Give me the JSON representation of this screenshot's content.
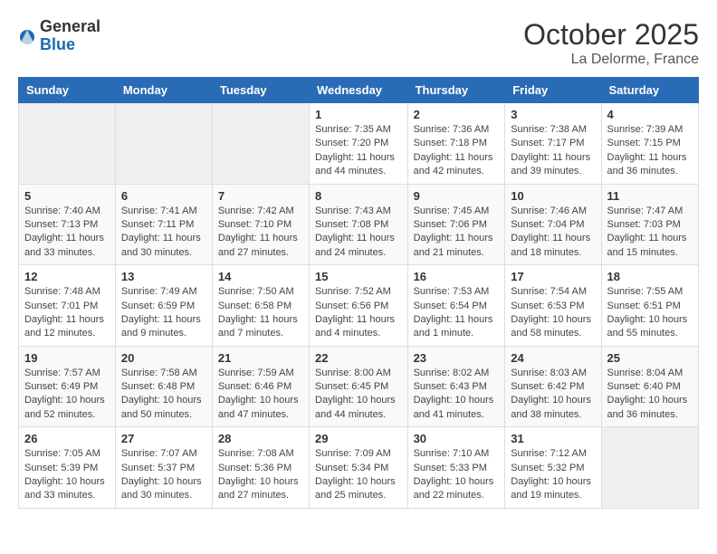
{
  "header": {
    "logo_general": "General",
    "logo_blue": "Blue",
    "month": "October 2025",
    "location": "La Delorme, France"
  },
  "days_of_week": [
    "Sunday",
    "Monday",
    "Tuesday",
    "Wednesday",
    "Thursday",
    "Friday",
    "Saturday"
  ],
  "weeks": [
    [
      {
        "day": "",
        "info": ""
      },
      {
        "day": "",
        "info": ""
      },
      {
        "day": "",
        "info": ""
      },
      {
        "day": "1",
        "info": "Sunrise: 7:35 AM\nSunset: 7:20 PM\nDaylight: 11 hours and 44 minutes."
      },
      {
        "day": "2",
        "info": "Sunrise: 7:36 AM\nSunset: 7:18 PM\nDaylight: 11 hours and 42 minutes."
      },
      {
        "day": "3",
        "info": "Sunrise: 7:38 AM\nSunset: 7:17 PM\nDaylight: 11 hours and 39 minutes."
      },
      {
        "day": "4",
        "info": "Sunrise: 7:39 AM\nSunset: 7:15 PM\nDaylight: 11 hours and 36 minutes."
      }
    ],
    [
      {
        "day": "5",
        "info": "Sunrise: 7:40 AM\nSunset: 7:13 PM\nDaylight: 11 hours and 33 minutes."
      },
      {
        "day": "6",
        "info": "Sunrise: 7:41 AM\nSunset: 7:11 PM\nDaylight: 11 hours and 30 minutes."
      },
      {
        "day": "7",
        "info": "Sunrise: 7:42 AM\nSunset: 7:10 PM\nDaylight: 11 hours and 27 minutes."
      },
      {
        "day": "8",
        "info": "Sunrise: 7:43 AM\nSunset: 7:08 PM\nDaylight: 11 hours and 24 minutes."
      },
      {
        "day": "9",
        "info": "Sunrise: 7:45 AM\nSunset: 7:06 PM\nDaylight: 11 hours and 21 minutes."
      },
      {
        "day": "10",
        "info": "Sunrise: 7:46 AM\nSunset: 7:04 PM\nDaylight: 11 hours and 18 minutes."
      },
      {
        "day": "11",
        "info": "Sunrise: 7:47 AM\nSunset: 7:03 PM\nDaylight: 11 hours and 15 minutes."
      }
    ],
    [
      {
        "day": "12",
        "info": "Sunrise: 7:48 AM\nSunset: 7:01 PM\nDaylight: 11 hours and 12 minutes."
      },
      {
        "day": "13",
        "info": "Sunrise: 7:49 AM\nSunset: 6:59 PM\nDaylight: 11 hours and 9 minutes."
      },
      {
        "day": "14",
        "info": "Sunrise: 7:50 AM\nSunset: 6:58 PM\nDaylight: 11 hours and 7 minutes."
      },
      {
        "day": "15",
        "info": "Sunrise: 7:52 AM\nSunset: 6:56 PM\nDaylight: 11 hours and 4 minutes."
      },
      {
        "day": "16",
        "info": "Sunrise: 7:53 AM\nSunset: 6:54 PM\nDaylight: 11 hours and 1 minute."
      },
      {
        "day": "17",
        "info": "Sunrise: 7:54 AM\nSunset: 6:53 PM\nDaylight: 10 hours and 58 minutes."
      },
      {
        "day": "18",
        "info": "Sunrise: 7:55 AM\nSunset: 6:51 PM\nDaylight: 10 hours and 55 minutes."
      }
    ],
    [
      {
        "day": "19",
        "info": "Sunrise: 7:57 AM\nSunset: 6:49 PM\nDaylight: 10 hours and 52 minutes."
      },
      {
        "day": "20",
        "info": "Sunrise: 7:58 AM\nSunset: 6:48 PM\nDaylight: 10 hours and 50 minutes."
      },
      {
        "day": "21",
        "info": "Sunrise: 7:59 AM\nSunset: 6:46 PM\nDaylight: 10 hours and 47 minutes."
      },
      {
        "day": "22",
        "info": "Sunrise: 8:00 AM\nSunset: 6:45 PM\nDaylight: 10 hours and 44 minutes."
      },
      {
        "day": "23",
        "info": "Sunrise: 8:02 AM\nSunset: 6:43 PM\nDaylight: 10 hours and 41 minutes."
      },
      {
        "day": "24",
        "info": "Sunrise: 8:03 AM\nSunset: 6:42 PM\nDaylight: 10 hours and 38 minutes."
      },
      {
        "day": "25",
        "info": "Sunrise: 8:04 AM\nSunset: 6:40 PM\nDaylight: 10 hours and 36 minutes."
      }
    ],
    [
      {
        "day": "26",
        "info": "Sunrise: 7:05 AM\nSunset: 5:39 PM\nDaylight: 10 hours and 33 minutes."
      },
      {
        "day": "27",
        "info": "Sunrise: 7:07 AM\nSunset: 5:37 PM\nDaylight: 10 hours and 30 minutes."
      },
      {
        "day": "28",
        "info": "Sunrise: 7:08 AM\nSunset: 5:36 PM\nDaylight: 10 hours and 27 minutes."
      },
      {
        "day": "29",
        "info": "Sunrise: 7:09 AM\nSunset: 5:34 PM\nDaylight: 10 hours and 25 minutes."
      },
      {
        "day": "30",
        "info": "Sunrise: 7:10 AM\nSunset: 5:33 PM\nDaylight: 10 hours and 22 minutes."
      },
      {
        "day": "31",
        "info": "Sunrise: 7:12 AM\nSunset: 5:32 PM\nDaylight: 10 hours and 19 minutes."
      },
      {
        "day": "",
        "info": ""
      }
    ]
  ]
}
